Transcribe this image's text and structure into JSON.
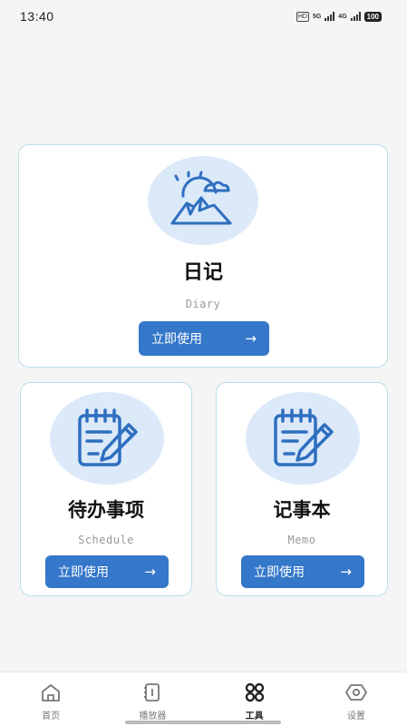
{
  "status_bar": {
    "time": "13:40",
    "hd_label": "HD",
    "net1": "5G",
    "net2": "4G",
    "battery": "100"
  },
  "cards": {
    "diary": {
      "title": "日记",
      "subtitle": "Diary",
      "button_label": "立即使用",
      "icon": "mountain-sun-icon"
    },
    "schedule": {
      "title": "待办事项",
      "subtitle": "Schedule",
      "button_label": "立即使用",
      "icon": "notepad-pencil-icon"
    },
    "memo": {
      "title": "记事本",
      "subtitle": "Memo",
      "button_label": "立即使用",
      "icon": "notepad-pencil-icon"
    }
  },
  "tab_bar": {
    "items": [
      {
        "label": "首页",
        "icon": "home-icon",
        "active": false
      },
      {
        "label": "播放器",
        "icon": "player-icon",
        "active": false
      },
      {
        "label": "工具",
        "icon": "tools-icon",
        "active": true
      },
      {
        "label": "设置",
        "icon": "settings-icon",
        "active": false
      }
    ]
  },
  "colors": {
    "accent": "#3577c9",
    "icon_bg": "#dbe9f9",
    "card_border": "#b9dfe8",
    "page_bg": "#f5f5f5"
  }
}
